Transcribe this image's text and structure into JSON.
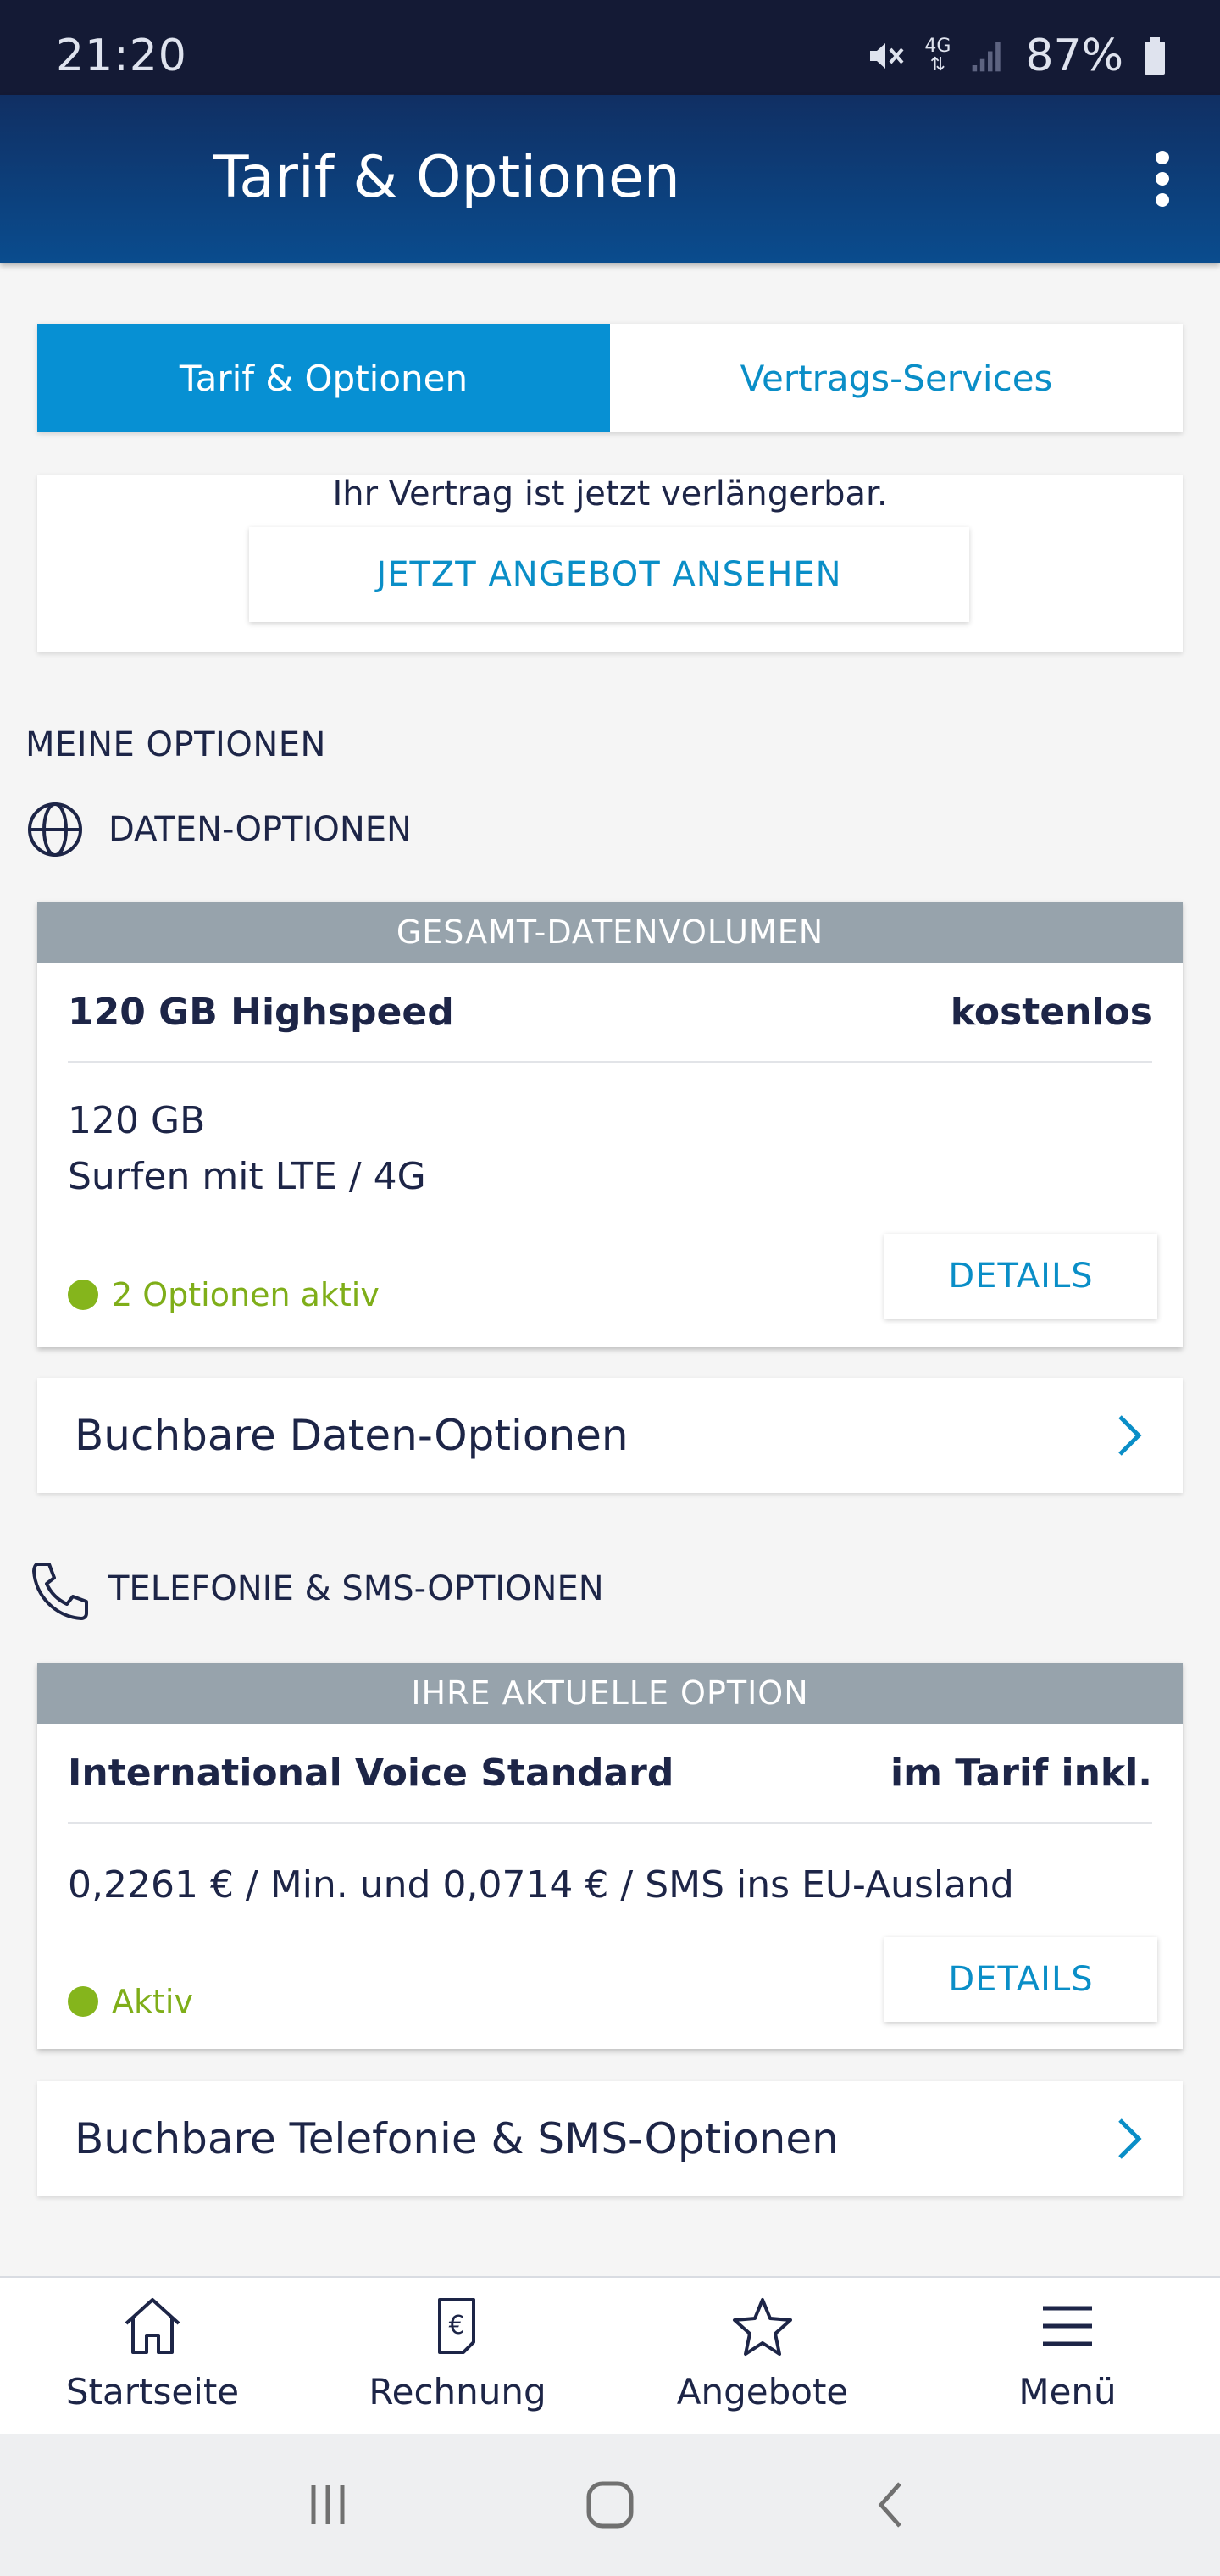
{
  "status_bar": {
    "time": "21:20",
    "network": "4G",
    "battery": "87%",
    "icons": [
      "mute-icon",
      "4g-icon",
      "signal-icon",
      "battery-icon"
    ]
  },
  "app_bar": {
    "title": "Tarif & Optionen",
    "menu_icon": "more-vertical-icon"
  },
  "tabs": [
    {
      "label": "Tarif & Optionen",
      "active": true
    },
    {
      "label": "Vertrags-Services",
      "active": false
    }
  ],
  "renewal": {
    "text": "Ihr Vertrag ist jetzt verlängerbar.",
    "button": "JETZT ANGEBOT ANSEHEN"
  },
  "my_options": {
    "title": "MEINE OPTIONEN",
    "data_section": {
      "title": "DATEN-OPTIONEN",
      "icon": "globe-icon",
      "card": {
        "header": "GESAMT-DATENVOLUMEN",
        "name": "120 GB Highspeed",
        "price": "kostenlos",
        "line1": "120 GB",
        "line2": "Surfen mit LTE / 4G",
        "status": "2 Optionen aktiv",
        "details": "DETAILS"
      },
      "link": "Buchbare Daten-Optionen"
    },
    "voice_section": {
      "title": "TELEFONIE & SMS-OPTIONEN",
      "icon": "phone-icon",
      "card": {
        "header": "IHRE AKTUELLE OPTION",
        "name": "International Voice Standard",
        "price": "im Tarif inkl.",
        "line1": "0,2261 € / Min. und 0,0714 € / SMS ins EU-Ausland",
        "status": "Aktiv",
        "details": "DETAILS"
      },
      "link": "Buchbare Telefonie & SMS-Optionen"
    }
  },
  "bottom_nav": [
    {
      "label": "Startseite",
      "icon": "home-icon"
    },
    {
      "label": "Rechnung",
      "icon": "invoice-euro-icon"
    },
    {
      "label": "Angebote",
      "icon": "star-icon"
    },
    {
      "label": "Menü",
      "icon": "hamburger-menu-icon"
    }
  ],
  "colors": {
    "accent": "#0790d3",
    "navy": "#1d2547",
    "status_green": "#85b51c",
    "card_header": "#97a3ac"
  }
}
